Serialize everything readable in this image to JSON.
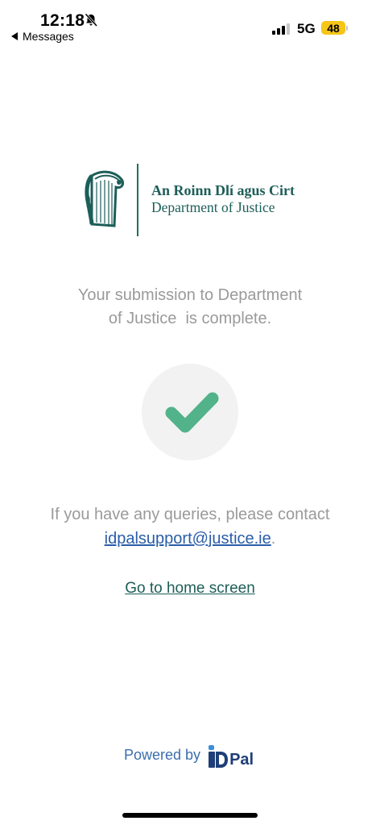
{
  "status_bar": {
    "time": "12:18",
    "back_label": "Messages",
    "network": "5G",
    "battery": "48",
    "battery_color": "#f5c518",
    "icons": [
      "bell-slash-icon",
      "signal-icon",
      "battery-icon"
    ]
  },
  "logo": {
    "line1": "An Roinn Dlí agus Cirt",
    "line2": "Department of Justice",
    "icon": "harp-icon",
    "color": "#1d5e58"
  },
  "message": {
    "line1": "Your submission to Department",
    "line2": "of Justice  is complete."
  },
  "status_icon": "checkmark-icon",
  "check_color": "#52b28a",
  "contact": {
    "line1": "If you have any queries, please contact",
    "email": "idpalsupport@justice.ie",
    "suffix": "."
  },
  "home_link": "Go to home screen",
  "footer": {
    "powered_by": "Powered by",
    "brand": "Pal",
    "brand_icon": "idpal-logo-icon"
  }
}
